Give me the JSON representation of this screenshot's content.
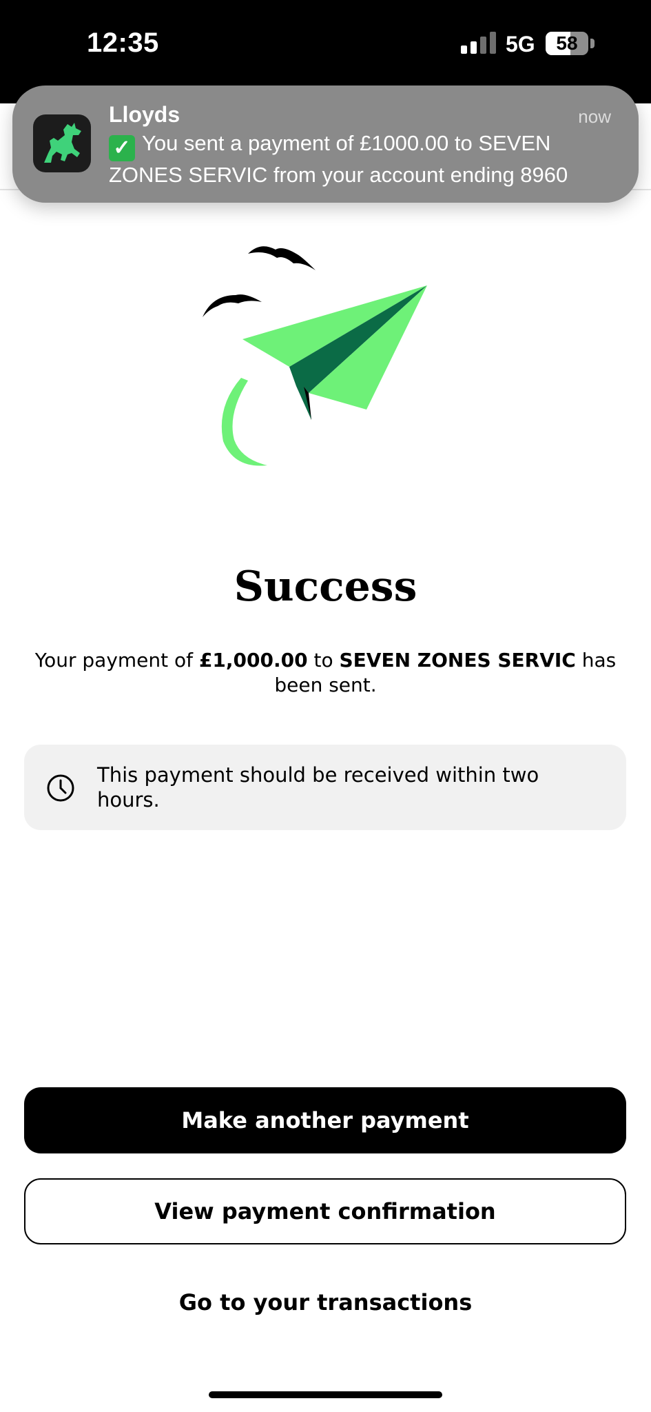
{
  "status_bar": {
    "time": "12:35",
    "network": "5G",
    "battery": "58"
  },
  "notification": {
    "app_name": "Lloyds",
    "time": "now",
    "message": "You sent a payment of £1000.00 to SEVEN ZONES SERVIC from your account ending 8960",
    "icon": "lloyds-horse-icon",
    "emoji": "check-mark-button-icon"
  },
  "illustration": {
    "icon": "paper-plane-with-birds-illustration",
    "accent_color": "#6ef178",
    "dark_accent_color": "#0b6b46"
  },
  "main": {
    "title": "Success",
    "message_prefix": "Your payment of ",
    "amount": "£1,000.00",
    "message_mid": " to ",
    "payee": "SEVEN ZONES SERVIC",
    "message_suffix": " has been sent.",
    "info_text": "This payment should be received within two hours.",
    "info_icon": "clock-icon"
  },
  "actions": {
    "primary_label": "Make another payment",
    "secondary_label": "View payment confirmation",
    "link_label": "Go to your transactions"
  },
  "colors": {
    "status_bar_bg": "#000000",
    "notification_bg": "#8a8a8a",
    "info_box_bg": "#f1f1f1",
    "primary_button_bg": "#000000"
  }
}
